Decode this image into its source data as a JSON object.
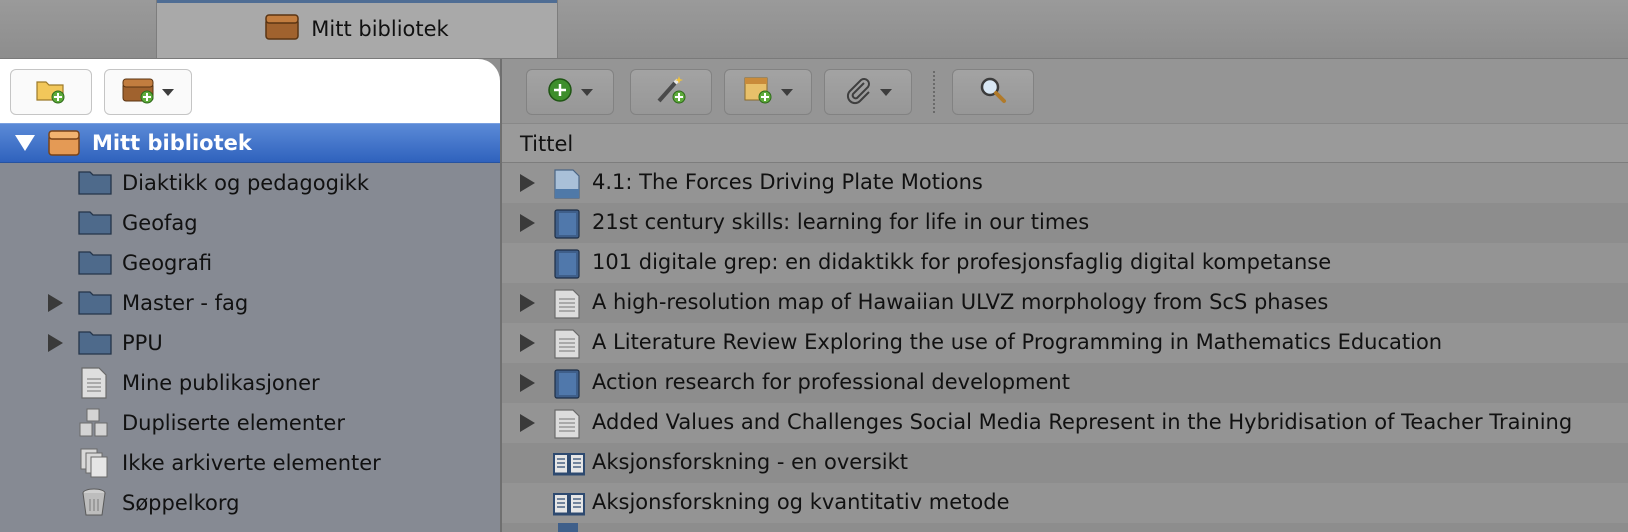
{
  "tab": {
    "label": "Mitt bibliotek",
    "icon": "library-box-icon"
  },
  "left_toolbar": {
    "buttons": [
      {
        "name": "new-collection-button",
        "icon": "new-folder-icon"
      },
      {
        "name": "new-library-button",
        "icon": "new-library-icon",
        "has_dropdown": true
      }
    ]
  },
  "tree": {
    "root": {
      "label": "Mitt bibliotek",
      "expanded": true,
      "selected": true
    },
    "items": [
      {
        "label": "Diaktikk og pedagogikk",
        "icon": "folder-icon",
        "expandable": false
      },
      {
        "label": "Geofag",
        "icon": "folder-icon",
        "expandable": false
      },
      {
        "label": "Geografi",
        "icon": "folder-icon",
        "expandable": false
      },
      {
        "label": "Master - fag",
        "icon": "folder-icon",
        "expandable": true
      },
      {
        "label": "PPU",
        "icon": "folder-icon",
        "expandable": true
      },
      {
        "label": "Mine publikasjoner",
        "icon": "document-icon",
        "expandable": false
      },
      {
        "label": "Dupliserte elementer",
        "icon": "duplicates-icon",
        "expandable": false
      },
      {
        "label": "Ikke arkiverte elementer",
        "icon": "unfiled-icon",
        "expandable": false
      },
      {
        "label": "Søppelkorg",
        "icon": "trash-icon",
        "expandable": false
      }
    ]
  },
  "right_toolbar": {
    "buttons": [
      {
        "name": "new-item-button",
        "icon": "add-icon",
        "has_dropdown": true
      },
      {
        "name": "add-by-identifier-button",
        "icon": "magic-wand-icon",
        "has_dropdown": false
      },
      {
        "name": "new-note-button",
        "icon": "new-note-icon",
        "has_dropdown": true
      },
      {
        "name": "add-attachment-button",
        "icon": "paperclip-icon",
        "has_dropdown": true
      },
      {
        "name": "search-button",
        "icon": "search-icon",
        "has_dropdown": false
      }
    ]
  },
  "columns": {
    "title": "Tittel"
  },
  "items": [
    {
      "title": "4.1: The Forces Driving Plate Motions",
      "icon": "webpage-icon",
      "expandable": true
    },
    {
      "title": "21st century skills: learning for life in our times",
      "icon": "book-icon",
      "expandable": true
    },
    {
      "title": "101 digitale grep: en didaktikk for profesjonsfaglig digital kompetanse",
      "icon": "book-icon",
      "expandable": false
    },
    {
      "title": "A high-resolution map of Hawaiian ULVZ morphology from ScS phases",
      "icon": "journal-article-icon",
      "expandable": true
    },
    {
      "title": "A Literature Review Exploring the use of Programming in Mathematics Education",
      "icon": "journal-article-icon",
      "expandable": true
    },
    {
      "title": "Action research for professional development",
      "icon": "book-icon",
      "expandable": true
    },
    {
      "title": "Added Values and Challenges Social Media Represent in the Hybridisation of Teacher Training",
      "icon": "journal-article-icon",
      "expandable": true
    },
    {
      "title": "Aksjonsforskning - en oversikt",
      "icon": "book-section-icon",
      "expandable": false
    },
    {
      "title": "Aksjonsforskning og kvantitativ metode",
      "icon": "book-section-icon",
      "expandable": false
    }
  ],
  "colors": {
    "selection": "#3d6fc8",
    "folder": "#4f6d8f",
    "book": "#3f5f8a"
  }
}
